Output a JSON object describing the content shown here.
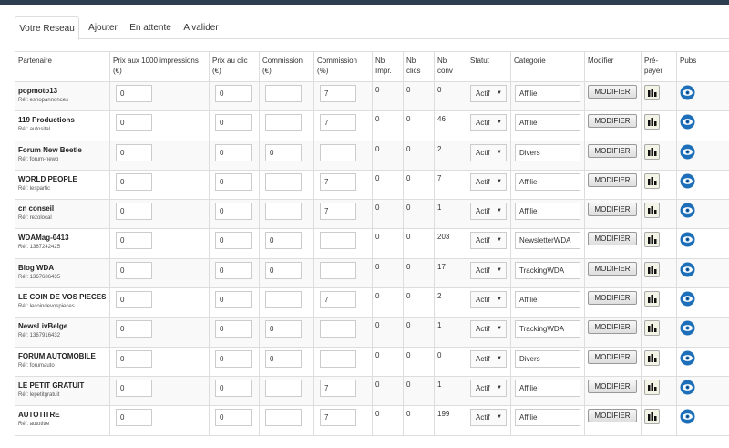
{
  "tabs": [
    {
      "label": "Votre Reseau",
      "active": true
    },
    {
      "label": "Ajouter",
      "active": false
    },
    {
      "label": "En attente",
      "active": false
    },
    {
      "label": "A valider",
      "active": false
    }
  ],
  "headers": {
    "partenaire": "Partenaire",
    "prix1000": "Prix aux 1000 impressions (€)",
    "prixclic": "Prix au clic (€)",
    "commission_eur": "Commission (€)",
    "commission_pct": "Commission (%)",
    "nb_impr": "Nb Impr.",
    "nb_clics": "Nb clics",
    "nb_conv": "Nb conv",
    "statut": "Statut",
    "categorie": "Categorie",
    "modifier": "Modifier",
    "prepayer": "Pré-payer",
    "pubs": "Pubs"
  },
  "modify_label": "MODIFIER",
  "rows": [
    {
      "name": "popmoto13",
      "ref": "Réf: eshopannonces",
      "prix1000": "0",
      "prixclic": "0",
      "commission_eur": "",
      "commission_pct": "7",
      "nb_impr": "0",
      "nb_clics": "0",
      "nb_conv": "0",
      "statut": "Actif",
      "categorie": "Affilie"
    },
    {
      "name": "119 Productions",
      "ref": "Réf: autosital",
      "prix1000": "0",
      "prixclic": "0",
      "commission_eur": "",
      "commission_pct": "7",
      "nb_impr": "0",
      "nb_clics": "0",
      "nb_conv": "46",
      "statut": "Actif",
      "categorie": "Affilie"
    },
    {
      "name": "Forum New Beetle",
      "ref": "Réf: forum-newb",
      "prix1000": "0",
      "prixclic": "0",
      "commission_eur": "0",
      "commission_pct": "",
      "nb_impr": "0",
      "nb_clics": "0",
      "nb_conv": "2",
      "statut": "Actif",
      "categorie": "Divers"
    },
    {
      "name": "WORLD PEOPLE",
      "ref": "Réf: lespartic",
      "prix1000": "0",
      "prixclic": "0",
      "commission_eur": "",
      "commission_pct": "7",
      "nb_impr": "0",
      "nb_clics": "0",
      "nb_conv": "7",
      "statut": "Actif",
      "categorie": "Affilie"
    },
    {
      "name": "cn conseil",
      "ref": "Réf: rezolocal",
      "prix1000": "0",
      "prixclic": "0",
      "commission_eur": "",
      "commission_pct": "7",
      "nb_impr": "0",
      "nb_clics": "0",
      "nb_conv": "1",
      "statut": "Actif",
      "categorie": "Affilie"
    },
    {
      "name": "WDAMag-0413",
      "ref": "Réf: 1367242425",
      "prix1000": "0",
      "prixclic": "0",
      "commission_eur": "0",
      "commission_pct": "",
      "nb_impr": "0",
      "nb_clics": "0",
      "nb_conv": "203",
      "statut": "Actif",
      "categorie": "NewsletterWDA"
    },
    {
      "name": "Blog WDA",
      "ref": "Réf: 1367686435",
      "prix1000": "0",
      "prixclic": "0",
      "commission_eur": "0",
      "commission_pct": "",
      "nb_impr": "0",
      "nb_clics": "0",
      "nb_conv": "17",
      "statut": "Actif",
      "categorie": "TrackingWDA"
    },
    {
      "name": "LE COIN DE VOS PIECES",
      "ref": "Réf: lecoindevospieces",
      "prix1000": "0",
      "prixclic": "0",
      "commission_eur": "",
      "commission_pct": "7",
      "nb_impr": "0",
      "nb_clics": "0",
      "nb_conv": "2",
      "statut": "Actif",
      "categorie": "Affilie"
    },
    {
      "name": "NewsLivBelge",
      "ref": "Réf: 1367916432",
      "prix1000": "0",
      "prixclic": "0",
      "commission_eur": "0",
      "commission_pct": "",
      "nb_impr": "0",
      "nb_clics": "0",
      "nb_conv": "1",
      "statut": "Actif",
      "categorie": "TrackingWDA"
    },
    {
      "name": "FORUM AUTOMOBILE",
      "ref": "Réf: forumauto",
      "prix1000": "0",
      "prixclic": "0",
      "commission_eur": "0",
      "commission_pct": "",
      "nb_impr": "0",
      "nb_clics": "0",
      "nb_conv": "0",
      "statut": "Actif",
      "categorie": "Divers"
    },
    {
      "name": "LE PETIT GRATUIT",
      "ref": "Réf: lepetitgratuit",
      "prix1000": "0",
      "prixclic": "0",
      "commission_eur": "",
      "commission_pct": "7",
      "nb_impr": "0",
      "nb_clics": "0",
      "nb_conv": "1",
      "statut": "Actif",
      "categorie": "Affilie"
    },
    {
      "name": "AUTOTITRE",
      "ref": "Réf: autotitre",
      "prix1000": "0",
      "prixclic": "0",
      "commission_eur": "",
      "commission_pct": "7",
      "nb_impr": "0",
      "nb_clics": "0",
      "nb_conv": "199",
      "statut": "Actif",
      "categorie": "Affilie"
    }
  ]
}
